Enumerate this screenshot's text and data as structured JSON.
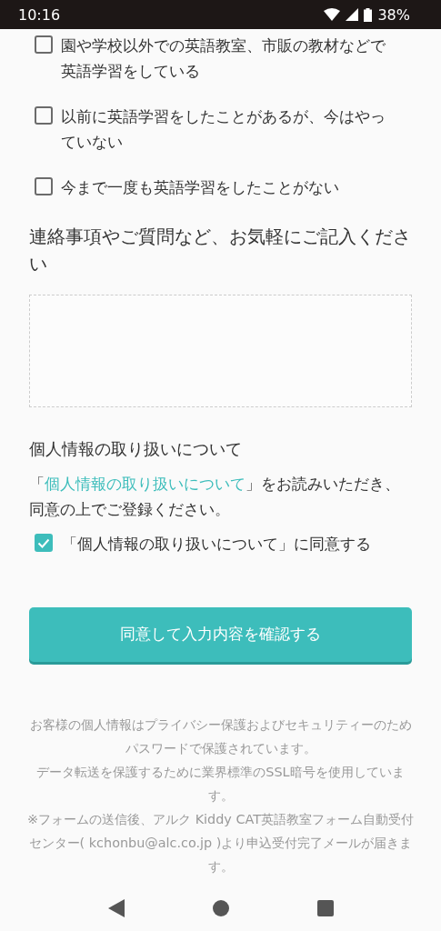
{
  "status_bar": {
    "time": "10:16",
    "battery": "38%"
  },
  "experience_options": [
    {
      "label": "園や学校以外での英語教室、市販の教材などで英語学習をしている",
      "checked": false
    },
    {
      "label": "以前に英語学習をしたことがあるが、今はやっていない",
      "checked": false
    },
    {
      "label": "今まで一度も英語学習をしたことがない",
      "checked": false
    }
  ],
  "comments": {
    "label": "連絡事項やご質問など、お気軽にご記入ください"
  },
  "privacy": {
    "heading": "個人情報の取り扱いについて",
    "link": "個人情報の取り扱いについて",
    "text_before": "「",
    "text_after": "」をお読みいただき、同意の上でご登録ください。",
    "agree_label": "「個人情報の取り扱いについて」に同意する",
    "agree_checked": true
  },
  "submit_button": "同意して入力内容を確認する",
  "footer_notes": [
    "お客様の個人情報はプライバシー保護およびセキュリティーのためパスワードで保護されています。",
    "データ転送を保護するために業界標準のSSL暗号を使用しています。",
    "※フォームの送信後、アルク Kiddy CAT英語教室フォーム自動受付センター( kchonbu@alc.co.jp )より申込受付完了メールが届きます。"
  ]
}
